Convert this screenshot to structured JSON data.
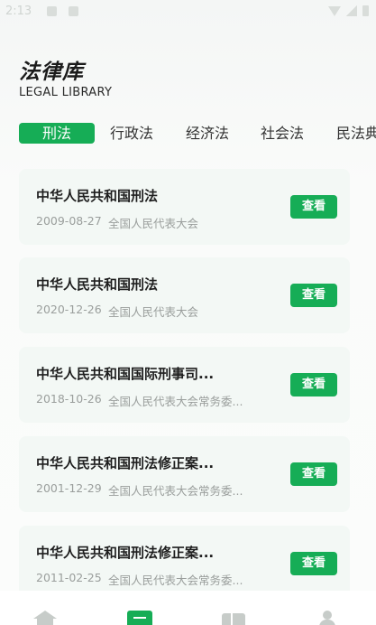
{
  "status_bar": {
    "time": "2:13"
  },
  "header": {
    "title": "法律库",
    "subtitle": "LEGAL LIBRARY"
  },
  "tabs": [
    {
      "label": "刑法",
      "active": true
    },
    {
      "label": "行政法",
      "active": false
    },
    {
      "label": "经济法",
      "active": false
    },
    {
      "label": "社会法",
      "active": false
    },
    {
      "label": "民法典",
      "active": false
    }
  ],
  "laws": [
    {
      "title": "中华人民共和国刑法",
      "date": "2009-08-27",
      "org": "全国人民代表大会",
      "action": "查看"
    },
    {
      "title": "中华人民共和国刑法",
      "date": "2020-12-26",
      "org": "全国人民代表大会",
      "action": "查看"
    },
    {
      "title": "中华人民共和国国际刑事司...",
      "date": "2018-10-26",
      "org": "全国人民代表大会常务委...",
      "action": "查看"
    },
    {
      "title": "中华人民共和国刑法修正案...",
      "date": "2001-12-29",
      "org": "全国人民代表大会常务委...",
      "action": "查看"
    },
    {
      "title": "中华人民共和国刑法修正案...",
      "date": "2011-02-25",
      "org": "全国人民代表大会常务委...",
      "action": "查看"
    }
  ],
  "colors": {
    "accent": "#16ad56",
    "card_bg": "#f3f8f5",
    "muted_text": "#9a9e9c"
  },
  "bottom_nav": [
    {
      "icon": "home-icon",
      "active": false
    },
    {
      "icon": "law-list-icon",
      "active": true
    },
    {
      "icon": "book-icon",
      "active": false
    },
    {
      "icon": "user-icon",
      "active": false
    }
  ]
}
